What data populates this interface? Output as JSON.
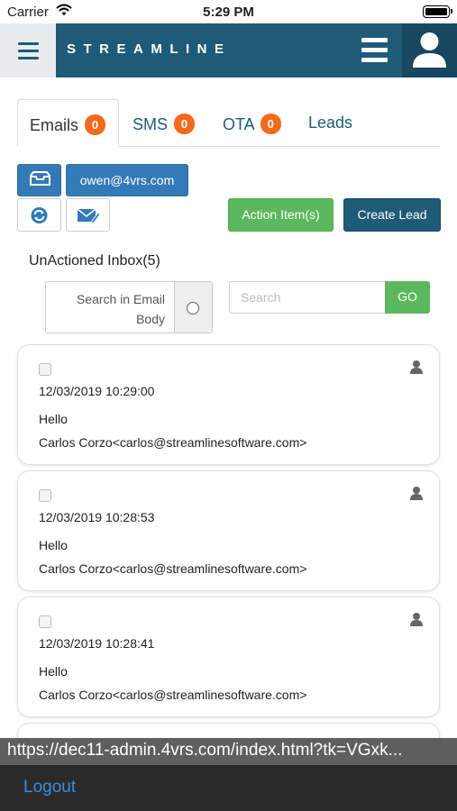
{
  "status_bar": {
    "carrier": "Carrier",
    "time": "5:29 PM"
  },
  "header": {
    "brand": "STREAMLINE"
  },
  "tabs": [
    {
      "label": "Emails",
      "count": "0"
    },
    {
      "label": "SMS",
      "count": "0"
    },
    {
      "label": "OTA",
      "count": "0"
    },
    {
      "label": "Leads"
    }
  ],
  "toolbar": {
    "account_label": "owen@4vrs.com",
    "action_items_label": "Action Item(s)",
    "create_lead_label": "Create Lead"
  },
  "inbox": {
    "title": "UnActioned Inbox(5)",
    "search_body_label_line1": "Search in Email",
    "search_body_label_line2": "Body",
    "search_placeholder": "Search",
    "go_label": "GO"
  },
  "emails": [
    {
      "date": "12/03/2019 10:29:00",
      "subject": "Hello",
      "sender": "Carlos Corzo<carlos@streamlinesoftware.com>"
    },
    {
      "date": "12/03/2019 10:28:53",
      "subject": "Hello",
      "sender": "Carlos Corzo<carlos@streamlinesoftware.com>"
    },
    {
      "date": "12/03/2019 10:28:41",
      "subject": "Hello",
      "sender": "Carlos Corzo<carlos@streamlinesoftware.com>"
    }
  ],
  "url_preview": "https://dec11-admin.4vrs.com/index.html?tk=VGxk...",
  "bottom": {
    "logout_label": "Logout"
  },
  "colors": {
    "header": "#1e5b78",
    "badge": "#f26a1b",
    "primary": "#337ab7",
    "success": "#5cb85c"
  },
  "icons": [
    "wifi-icon",
    "battery-icon",
    "hamburger-menu-icon",
    "list-icon",
    "user-icon",
    "inbox-tray-icon",
    "refresh-icon",
    "compose-email-icon",
    "person-icon"
  ]
}
